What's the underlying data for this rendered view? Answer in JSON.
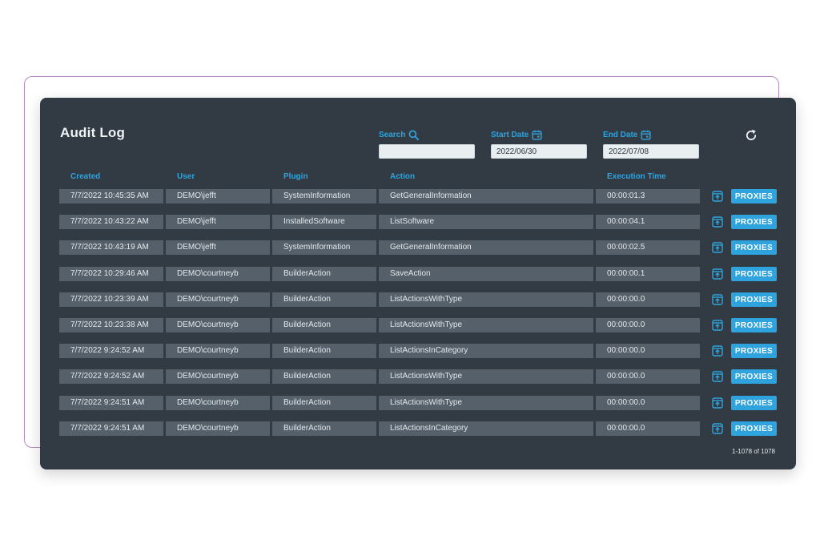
{
  "title": "Audit Log",
  "filters": {
    "search": {
      "label": "Search",
      "value": ""
    },
    "start_date": {
      "label": "Start Date",
      "value": "2022/06/30"
    },
    "end_date": {
      "label": "End Date",
      "value": "2022/07/08"
    }
  },
  "columns": {
    "created": "Created",
    "user": "User",
    "plugin": "Plugin",
    "action": "Action",
    "execution_time": "Execution Time"
  },
  "proxies_label": "PROXIES",
  "rows": [
    {
      "created": "7/7/2022 10:45:35 AM",
      "user": "DEMO\\jefft",
      "plugin": "SystemInformation",
      "action": "GetGeneralInformation",
      "execution_time": "00:00:01.3"
    },
    {
      "created": "7/7/2022 10:43:22 AM",
      "user": "DEMO\\jefft",
      "plugin": "InstalledSoftware",
      "action": "ListSoftware",
      "execution_time": "00:00:04.1"
    },
    {
      "created": "7/7/2022 10:43:19 AM",
      "user": "DEMO\\jefft",
      "plugin": "SystemInformation",
      "action": "GetGeneralInformation",
      "execution_time": "00:00:02.5"
    },
    {
      "created": "7/7/2022 10:29:46 AM",
      "user": "DEMO\\courtneyb",
      "plugin": "BuilderAction",
      "action": "SaveAction",
      "execution_time": "00:00:00.1"
    },
    {
      "created": "7/7/2022 10:23:39 AM",
      "user": "DEMO\\courtneyb",
      "plugin": "BuilderAction",
      "action": "ListActionsWithType",
      "execution_time": "00:00:00.0"
    },
    {
      "created": "7/7/2022 10:23:38 AM",
      "user": "DEMO\\courtneyb",
      "plugin": "BuilderAction",
      "action": "ListActionsWithType",
      "execution_time": "00:00:00.0"
    },
    {
      "created": "7/7/2022 9:24:52 AM",
      "user": "DEMO\\courtneyb",
      "plugin": "BuilderAction",
      "action": "ListActionsInCategory",
      "execution_time": "00:00:00.0"
    },
    {
      "created": "7/7/2022 9:24:52 AM",
      "user": "DEMO\\courtneyb",
      "plugin": "BuilderAction",
      "action": "ListActionsWithType",
      "execution_time": "00:00:00.0"
    },
    {
      "created": "7/7/2022 9:24:51 AM",
      "user": "DEMO\\courtneyb",
      "plugin": "BuilderAction",
      "action": "ListActionsWithType",
      "execution_time": "00:00:00.0"
    },
    {
      "created": "7/7/2022 9:24:51 AM",
      "user": "DEMO\\courtneyb",
      "plugin": "BuilderAction",
      "action": "ListActionsInCategory",
      "execution_time": "00:00:00.0"
    }
  ],
  "pagination": "1-1078 of 1078",
  "icons": {
    "search": "search-icon",
    "calendar": "calendar-icon",
    "refresh": "refresh-icon",
    "row_action": "export-icon"
  },
  "colors": {
    "panel_bg": "#323b44",
    "cell_bg": "#55606b",
    "accent": "#2fa3dd",
    "outline": "#b98ac8"
  }
}
